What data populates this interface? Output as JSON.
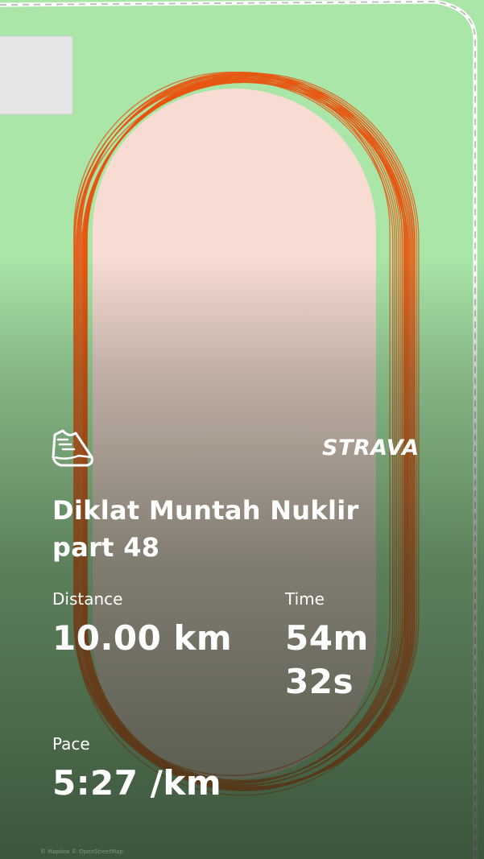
{
  "activity": {
    "title": "Diklat Muntah Nuklir part 48",
    "type_icon": "running-shoe-icon"
  },
  "brand": {
    "name": "STRAVA"
  },
  "stats": {
    "distance": {
      "label": "Distance",
      "value": "10.00 km"
    },
    "time": {
      "label": "Time",
      "value": "54m 32s"
    },
    "pace": {
      "label": "Pace",
      "value": "5:27 /km"
    }
  },
  "map": {
    "attribution": "© Mapbox © OpenStreetMap",
    "colors": {
      "grass": "#a9e6a8",
      "track_fill": "#f8dcd4",
      "route": "#e8540f",
      "building": "#e6e4e6"
    }
  }
}
